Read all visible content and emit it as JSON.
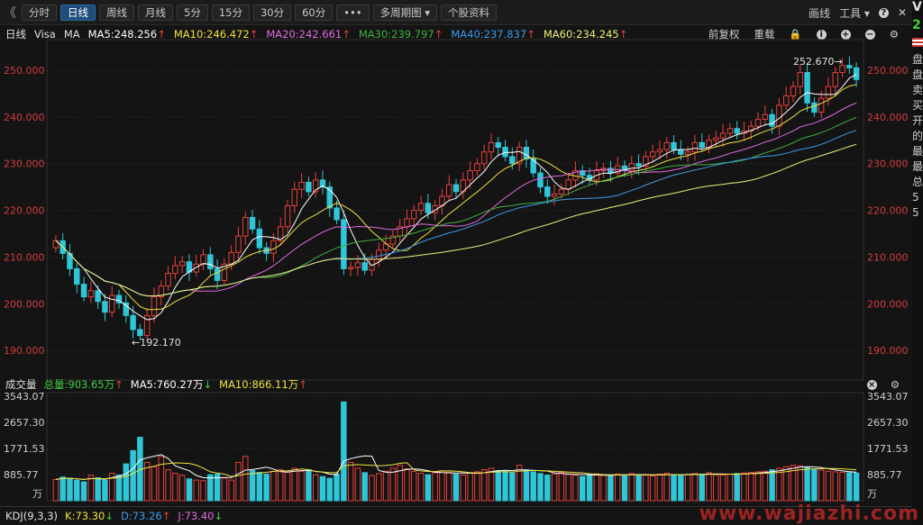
{
  "toolbar": {
    "back": "《",
    "periods": [
      {
        "label": "分时",
        "active": false
      },
      {
        "label": "日线",
        "active": true
      },
      {
        "label": "周线",
        "active": false
      },
      {
        "label": "月线",
        "active": false
      },
      {
        "label": "5分",
        "active": false
      },
      {
        "label": "15分",
        "active": false
      },
      {
        "label": "30分",
        "active": false
      },
      {
        "label": "60分",
        "active": false
      }
    ],
    "more": "•••",
    "multi_period": "多周期图",
    "stock_info": "个股资料",
    "draw_line": "画线",
    "tools": "工具",
    "help": "?",
    "corner": "V"
  },
  "info": {
    "period": "日线",
    "symbol": "Visa",
    "ma_label": "MA",
    "ma5": "MA5:248.256",
    "ma10": "MA10:246.472",
    "ma20": "MA20:242.661",
    "ma30": "MA30:239.797",
    "ma40": "MA40:237.837",
    "ma60": "MA60:234.245",
    "restore": "前复权",
    "reset": "重载"
  },
  "colors": {
    "up": "#e8413a",
    "down": "#2fc6d8",
    "ma5": "#ffffff",
    "ma10": "#f0e13c",
    "ma20": "#e26be2",
    "ma30": "#40b040",
    "ma40": "#3d9be8",
    "ma60": "#efef7a",
    "axis": "#d23c3c"
  },
  "price_axis": [
    "250.000",
    "240.000",
    "230.000",
    "220.000",
    "210.000",
    "200.000",
    "190.000"
  ],
  "annotations": {
    "high": "252.670",
    "low": "192.170"
  },
  "volume": {
    "label": "成交量",
    "total": "总量:903.65万",
    "ma5": "MA5:760.27万",
    "ma10": "MA10:866.11万",
    "axis": [
      "3543.07",
      "2657.30",
      "1771.53",
      "885.77"
    ],
    "unit": "万"
  },
  "kdj": {
    "label": "KDJ(9,3,3)",
    "k": "K:73.30",
    "d": "D:73.26",
    "j": "J:73.40"
  },
  "side_chars": [
    "V",
    "2",
    "",
    "盘",
    "盘",
    "卖",
    "买",
    "开",
    "的",
    "最",
    "最",
    "总",
    "5",
    "5"
  ],
  "watermark": "www.wajiazhi.com",
  "chart_data": {
    "type": "candlestick",
    "title": "Visa",
    "ylim": [
      186,
      255
    ],
    "volume_ylim": [
      0,
      3543.07
    ],
    "closes": [
      213.5,
      210.8,
      207.5,
      204.2,
      201.5,
      202.8,
      200.5,
      198.2,
      201.8,
      200.2,
      197.5,
      194.5,
      193.2,
      197.5,
      201.5,
      203.8,
      206.5,
      208.2,
      209.0,
      206.8,
      208.5,
      210.5,
      207.5,
      205.0,
      208.5,
      211.0,
      214.5,
      218.5,
      216.0,
      212.0,
      210.8,
      213.5,
      216.5,
      221.0,
      224.5,
      226.0,
      224.0,
      226.5,
      225.0,
      220.5,
      218.0,
      207.5,
      207.8,
      208.8,
      207.2,
      209.5,
      211.5,
      212.8,
      214.5,
      216.5,
      218.2,
      220.0,
      221.5,
      219.5,
      221.0,
      223.0,
      225.5,
      224.0,
      226.5,
      228.5,
      230.0,
      232.5,
      234.5,
      233.5,
      231.5,
      230.0,
      233.5,
      231.0,
      228.0,
      225.0,
      223.0,
      223.5,
      224.5,
      226.5,
      228.5,
      227.5,
      226.5,
      228.5,
      229.0,
      228.0,
      229.5,
      228.5,
      230.0,
      229.5,
      231.5,
      232.5,
      233.0,
      234.5,
      233.0,
      232.0,
      232.5,
      234.5,
      233.5,
      235.0,
      235.5,
      236.5,
      237.5,
      236.5,
      237.0,
      238.0,
      239.5,
      240.5,
      238.0,
      242.5,
      244.5,
      246.5,
      249.5,
      243.0,
      241.0,
      244.0,
      246.5,
      249.5,
      251.0,
      250.5,
      248.0
    ],
    "opens": [
      212.0,
      213.5,
      210.8,
      207.5,
      204.2,
      201.5,
      202.8,
      200.5,
      198.2,
      201.8,
      200.2,
      197.5,
      194.5,
      193.2,
      197.5,
      201.5,
      203.8,
      206.5,
      208.2,
      209.0,
      206.8,
      208.5,
      210.5,
      207.5,
      205.0,
      208.5,
      211.0,
      214.5,
      218.5,
      216.0,
      212.0,
      210.8,
      213.5,
      216.5,
      221.0,
      224.5,
      226.0,
      224.0,
      226.5,
      225.0,
      220.5,
      218.0,
      207.5,
      207.8,
      208.8,
      207.2,
      209.5,
      211.5,
      212.8,
      214.5,
      216.5,
      218.2,
      220.0,
      221.5,
      219.5,
      221.0,
      223.0,
      225.5,
      224.0,
      226.5,
      228.5,
      230.0,
      232.5,
      234.5,
      233.5,
      231.5,
      230.0,
      233.5,
      231.0,
      228.0,
      225.0,
      223.0,
      223.5,
      224.5,
      226.5,
      228.5,
      227.5,
      226.5,
      228.5,
      229.0,
      228.0,
      229.5,
      228.5,
      230.0,
      229.5,
      231.5,
      232.5,
      233.0,
      234.5,
      233.0,
      232.0,
      232.5,
      234.5,
      233.5,
      235.0,
      235.5,
      236.5,
      237.5,
      236.5,
      237.0,
      238.0,
      239.5,
      240.5,
      238.0,
      242.5,
      244.5,
      246.5,
      249.5,
      243.0,
      241.0,
      244.0,
      246.5,
      249.5,
      251.0,
      250.5
    ],
    "volumes": [
      720,
      800,
      760,
      690,
      640,
      860,
      780,
      700,
      930,
      870,
      1250,
      1700,
      2150,
      1300,
      1150,
      1500,
      1050,
      930,
      860,
      740,
      700,
      680,
      880,
      900,
      770,
      700,
      1300,
      1500,
      1020,
      960,
      900,
      1000,
      1050,
      960,
      1100,
      990,
      1050,
      880,
      820,
      760,
      900,
      3350,
      1300,
      1100,
      950,
      850,
      920,
      1000,
      1100,
      1200,
      1080,
      990,
      930,
      880,
      950,
      1020,
      960,
      900,
      870,
      930,
      980,
      1050,
      1100,
      1020,
      990,
      940,
      1200,
      1050,
      980,
      920,
      870,
      900,
      960,
      890,
      860,
      820,
      880,
      910,
      860,
      850,
      900,
      870,
      920,
      880,
      860,
      840,
      900,
      930,
      880,
      860,
      890,
      920,
      900,
      950,
      880,
      870,
      900,
      920,
      940,
      960,
      980,
      1000,
      1050,
      1100,
      1150,
      1200,
      1180,
      1120,
      1080,
      1040,
      1000,
      980,
      960,
      950,
      940
    ]
  }
}
